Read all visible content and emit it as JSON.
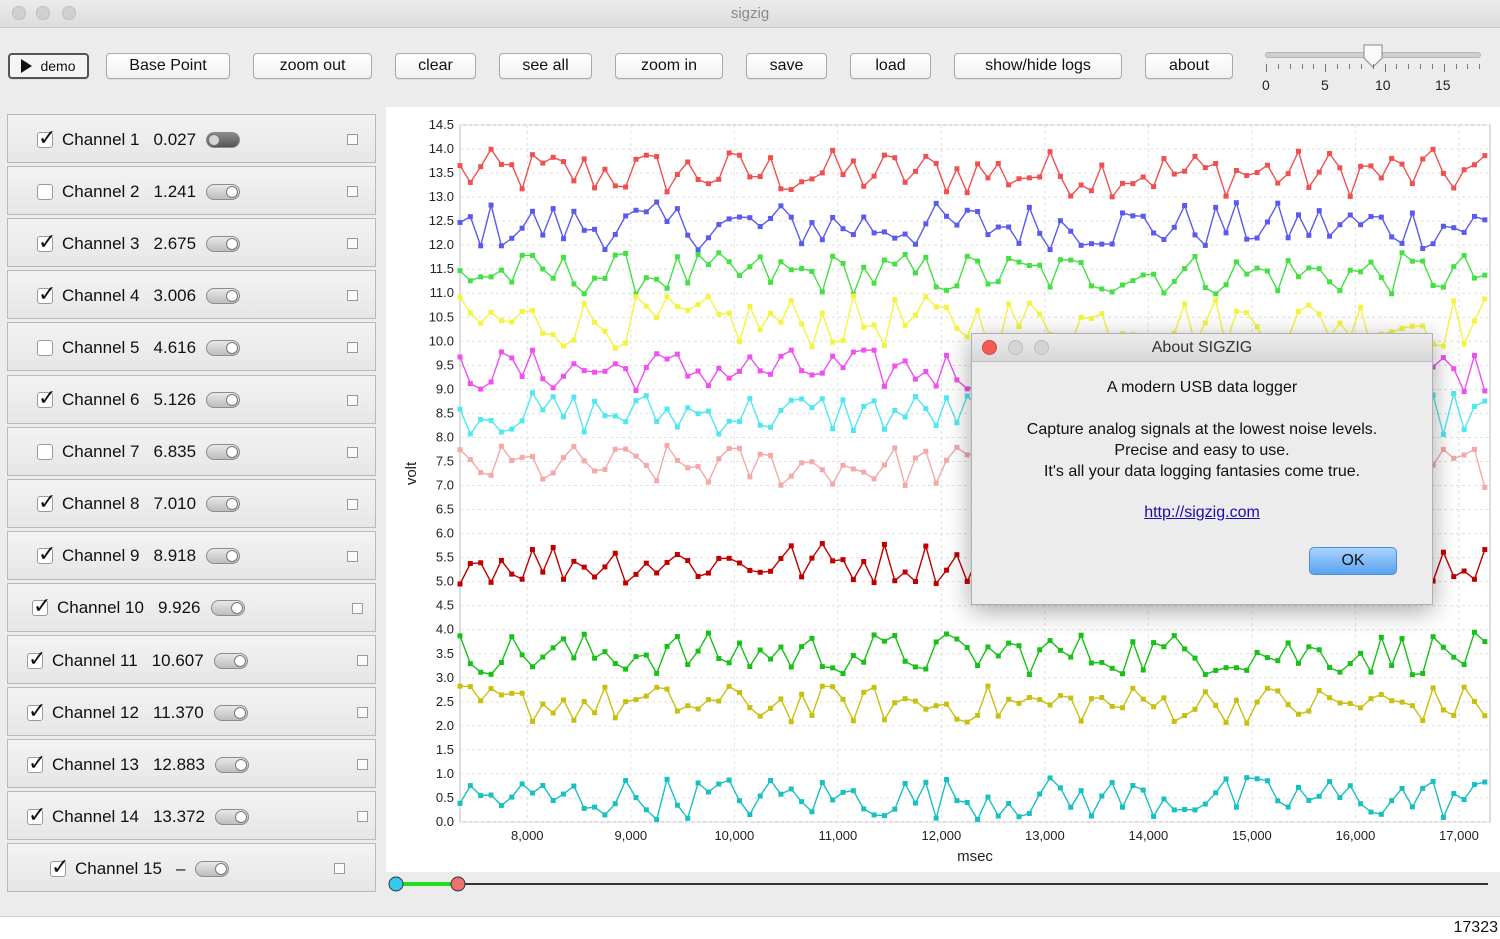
{
  "window": {
    "title": "sigzig"
  },
  "toolbar": {
    "demo_label": "demo",
    "buttons": [
      "Base Point",
      "zoom out",
      "clear",
      "see all",
      "zoom in",
      "save",
      "load",
      "show/hide logs",
      "about"
    ]
  },
  "speed_slider": {
    "tick_labels": [
      "0",
      "5",
      "10",
      "15"
    ],
    "value": 9
  },
  "channels": [
    {
      "name": "Channel 1",
      "value": "0.027",
      "checked": true,
      "toggle_on": false
    },
    {
      "name": "Channel 2",
      "value": "1.241",
      "checked": false,
      "toggle_on": true
    },
    {
      "name": "Channel 3",
      "value": "2.675",
      "checked": true,
      "toggle_on": true
    },
    {
      "name": "Channel 4",
      "value": "3.006",
      "checked": true,
      "toggle_on": true
    },
    {
      "name": "Channel 5",
      "value": "4.616",
      "checked": false,
      "toggle_on": true
    },
    {
      "name": "Channel 6",
      "value": "5.126",
      "checked": true,
      "toggle_on": true
    },
    {
      "name": "Channel 7",
      "value": "6.835",
      "checked": false,
      "toggle_on": true
    },
    {
      "name": "Channel 8",
      "value": "7.010",
      "checked": true,
      "toggle_on": true
    },
    {
      "name": "Channel 9",
      "value": "8.918",
      "checked": true,
      "toggle_on": true
    },
    {
      "name": "Channel 10",
      "value": "9.926",
      "checked": true,
      "toggle_on": true
    },
    {
      "name": "Channel 11",
      "value": "10.607",
      "checked": true,
      "toggle_on": true
    },
    {
      "name": "Channel 12",
      "value": "11.370",
      "checked": true,
      "toggle_on": true
    },
    {
      "name": "Channel 13",
      "value": "12.883",
      "checked": true,
      "toggle_on": true
    },
    {
      "name": "Channel 14",
      "value": "13.372",
      "checked": true,
      "toggle_on": true
    },
    {
      "name": "Channel 15",
      "value": "–",
      "checked": true,
      "toggle_on": true
    }
  ],
  "chart_data": {
    "type": "line",
    "xlabel": "msec",
    "ylabel": "volt",
    "xlim": [
      7350,
      17300
    ],
    "ylim": [
      0.0,
      14.5
    ],
    "x_ticks": [
      "8,000",
      "9,000",
      "10,000",
      "11,000",
      "12,000",
      "13,000",
      "14,000",
      "15,000",
      "16,000",
      "17,000"
    ],
    "y_ticks": [
      "0.0",
      "0.5",
      "1.0",
      "1.5",
      "2.0",
      "2.5",
      "3.0",
      "3.5",
      "4.0",
      "4.5",
      "5.0",
      "5.5",
      "6.0",
      "6.5",
      "7.0",
      "7.5",
      "8.0",
      "8.5",
      "9.0",
      "9.5",
      "10.0",
      "10.5",
      "11.0",
      "11.5",
      "12.0",
      "12.5",
      "13.0",
      "13.5",
      "14.0",
      "14.5"
    ],
    "grid": true,
    "sample_interval_msec": 100,
    "series": [
      {
        "color": "#f05050",
        "center": 13.5,
        "amplitude": 0.5
      },
      {
        "color": "#5a5af0",
        "center": 12.4,
        "amplitude": 0.5
      },
      {
        "color": "#44e044",
        "center": 11.4,
        "amplitude": 0.45
      },
      {
        "color": "#f4f440",
        "center": 10.4,
        "amplitude": 0.55
      },
      {
        "color": "#f050f0",
        "center": 9.4,
        "amplitude": 0.45
      },
      {
        "color": "#50e8f0",
        "center": 8.5,
        "amplitude": 0.45
      },
      {
        "color": "#f4a8a8",
        "center": 7.4,
        "amplitude": 0.45
      },
      {
        "color": "#c00000",
        "center": 5.4,
        "amplitude": 0.45
      },
      {
        "color": "#18c018",
        "center": 3.5,
        "amplitude": 0.45
      },
      {
        "color": "#c8c010",
        "center": 2.45,
        "amplitude": 0.4
      },
      {
        "color": "#18c0c0",
        "center": 0.5,
        "amplitude": 0.45
      }
    ]
  },
  "range_slider": {
    "start": 0.0,
    "end": 0.06
  },
  "status": {
    "count": "17323"
  },
  "about_dialog": {
    "title": "About SIGZIG",
    "tagline": "A modern USB data logger",
    "line1": "Capture analog signals at the lowest noise levels.",
    "line2": "Precise and easy to use.",
    "line3": "It's all your data logging fantasies come true.",
    "link": "http://sigzig.com",
    "ok_label": "OK"
  }
}
